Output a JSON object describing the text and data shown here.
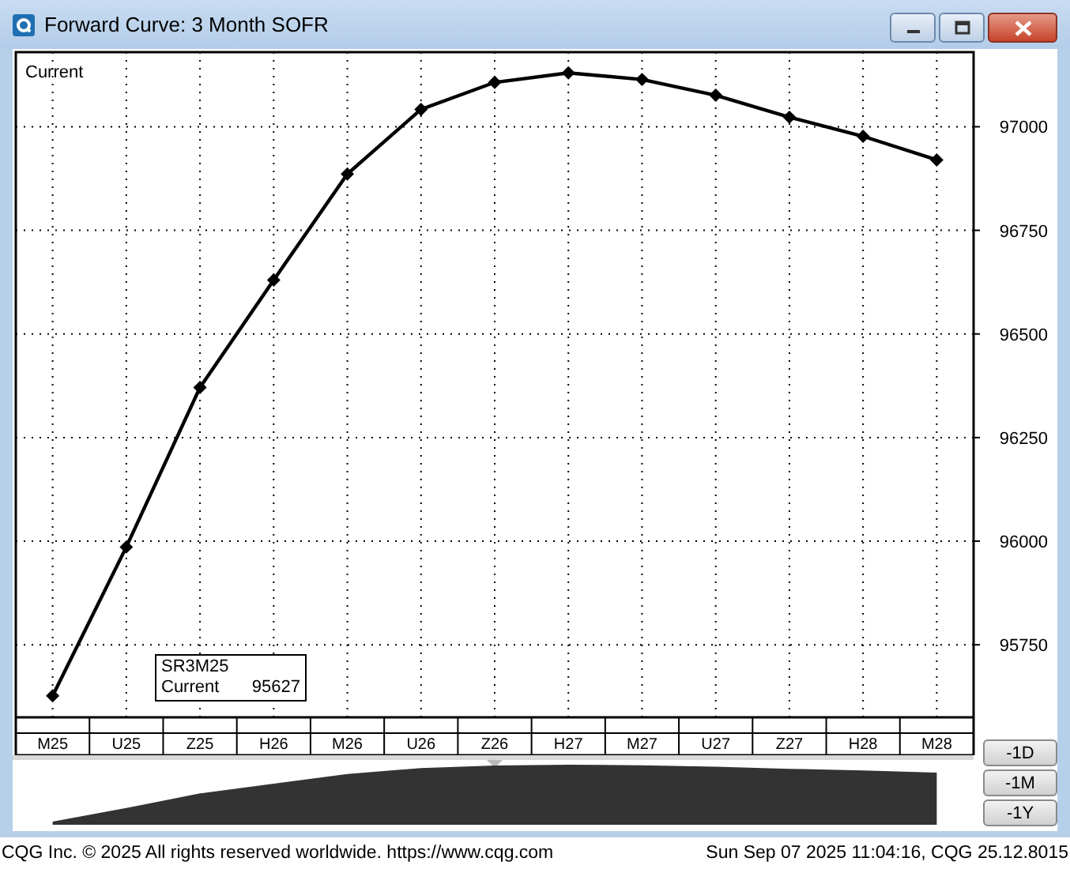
{
  "window": {
    "title": "Forward Curve: 3 Month SOFR"
  },
  "chart": {
    "chart_data": {
      "type": "line",
      "categories": [
        "M25",
        "U25",
        "Z25",
        "H26",
        "M26",
        "U26",
        "Z26",
        "H27",
        "M27",
        "U27",
        "Z27",
        "H28",
        "M28"
      ],
      "series": [
        {
          "name": "Current",
          "color": "#000000",
          "marker": "diamond",
          "values": [
            95627,
            95986,
            96371,
            96630,
            96886,
            97042,
            97107,
            97130,
            97114,
            97076,
            97023,
            96977,
            96920
          ]
        }
      ],
      "grid": true,
      "ylim": [
        95575,
        97180
      ],
      "yticks": [
        95750,
        96000,
        96250,
        96500,
        96750,
        97000
      ]
    }
  },
  "tooltip": {
    "symbol": "SR3M25",
    "label": "Current",
    "value": "95627"
  },
  "range_buttons": [
    "-1D",
    "-1M",
    "-1Y"
  ],
  "status_bar": {
    "left": "CQG Inc. © 2025 All rights reserved worldwide. https://www.cqg.com",
    "right": "Sun Sep 07 2025 11:04:16, CQG 25.12.8015"
  }
}
